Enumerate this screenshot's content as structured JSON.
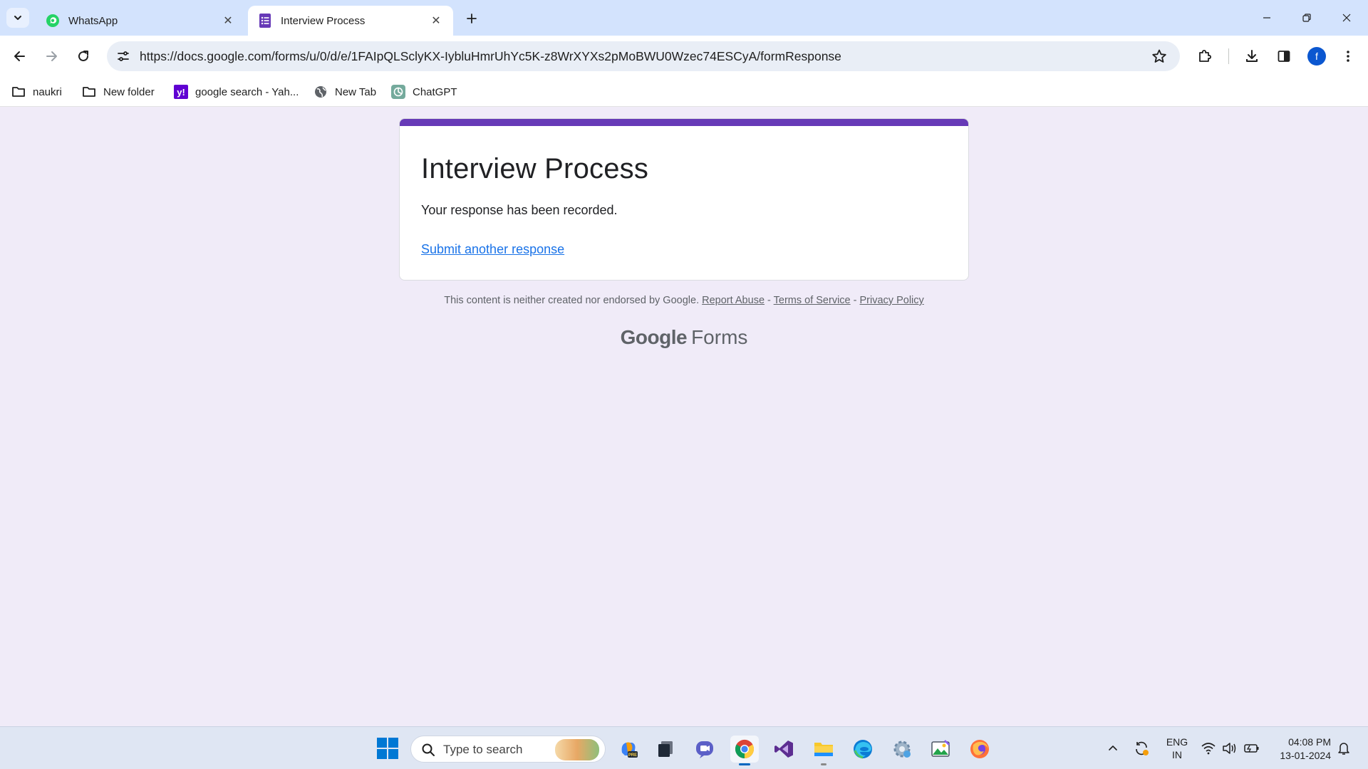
{
  "browser": {
    "tabs": [
      {
        "title": "WhatsApp",
        "active": false,
        "icon": "whatsapp-icon"
      },
      {
        "title": "Interview Process",
        "active": true,
        "icon": "google-forms-icon"
      }
    ],
    "url": "https://docs.google.com/forms/u/0/d/e/1FAIpQLSclyKX-IybluHmrUhYc5K-z8WrXYXs2pMoBWU0Wzec74ESCyA/formResponse",
    "profile_initial": "f",
    "bookmarks": [
      {
        "label": "naukri",
        "icon": "folder-icon"
      },
      {
        "label": "New folder",
        "icon": "folder-icon"
      },
      {
        "label": "google search - Yah...",
        "icon": "yahoo-icon"
      },
      {
        "label": "New Tab",
        "icon": "globe-icon"
      },
      {
        "label": "ChatGPT",
        "icon": "chatgpt-icon"
      }
    ]
  },
  "form": {
    "title": "Interview Process",
    "confirmation": "Your response has been recorded.",
    "submit_another": "Submit another response",
    "accent_color": "#673ab7"
  },
  "footer": {
    "disclaimer": "This content is neither created nor endorsed by Google.",
    "report_abuse": "Report Abuse",
    "sep1": " - ",
    "terms": "Terms of Service",
    "sep2": " - ",
    "privacy": "Privacy Policy",
    "brand_google": "Google",
    "brand_forms": "Forms"
  },
  "taskbar": {
    "search_placeholder": "Type to search",
    "language_line1": "ENG",
    "language_line2": "IN",
    "time": "04:08 PM",
    "date": "13-01-2024",
    "apps": [
      "copilot-icon",
      "file-manager-icon",
      "teams-icon",
      "chrome-icon",
      "visual-studio-icon",
      "file-explorer-icon",
      "edge-icon",
      "settings-gear-icon",
      "photo-editor-icon",
      "firefox-icon"
    ]
  }
}
